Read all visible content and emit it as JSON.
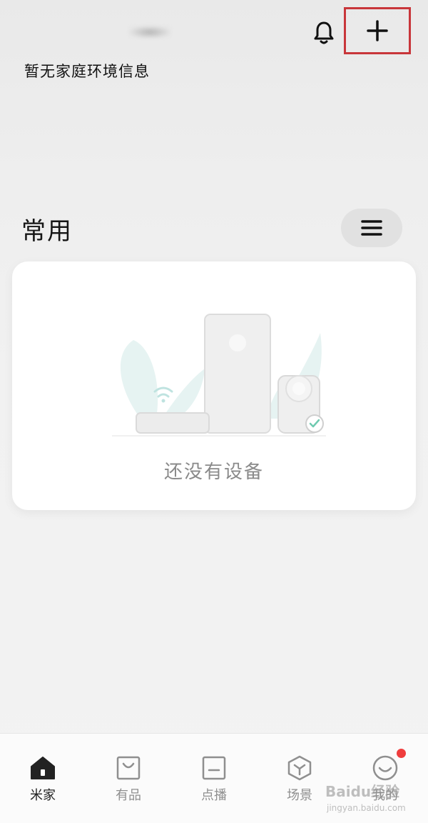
{
  "header": {
    "env_info": "暂无家庭环境信息",
    "notification_icon": "bell-icon",
    "add_icon": "plus-icon",
    "highlight_color": "#c8363a"
  },
  "favorites": {
    "title": "常用",
    "menu_icon": "hamburger-menu-icon",
    "empty_state": {
      "illustration": "devices-illustration",
      "text": "还没有设备"
    }
  },
  "tabbar": {
    "tabs": [
      {
        "label": "米家",
        "icon": "home-icon",
        "active": true
      },
      {
        "label": "有品",
        "icon": "shopping-bag-icon",
        "active": false
      },
      {
        "label": "点播",
        "icon": "video-icon",
        "active": false
      },
      {
        "label": "场景",
        "icon": "cube-icon",
        "active": false
      },
      {
        "label": "我的",
        "icon": "smiley-icon",
        "active": false
      }
    ],
    "notification_dot_color": "#ef3d3d"
  },
  "watermark": {
    "text": "Baidu经验",
    "sub": "jingyan.baidu.com"
  }
}
